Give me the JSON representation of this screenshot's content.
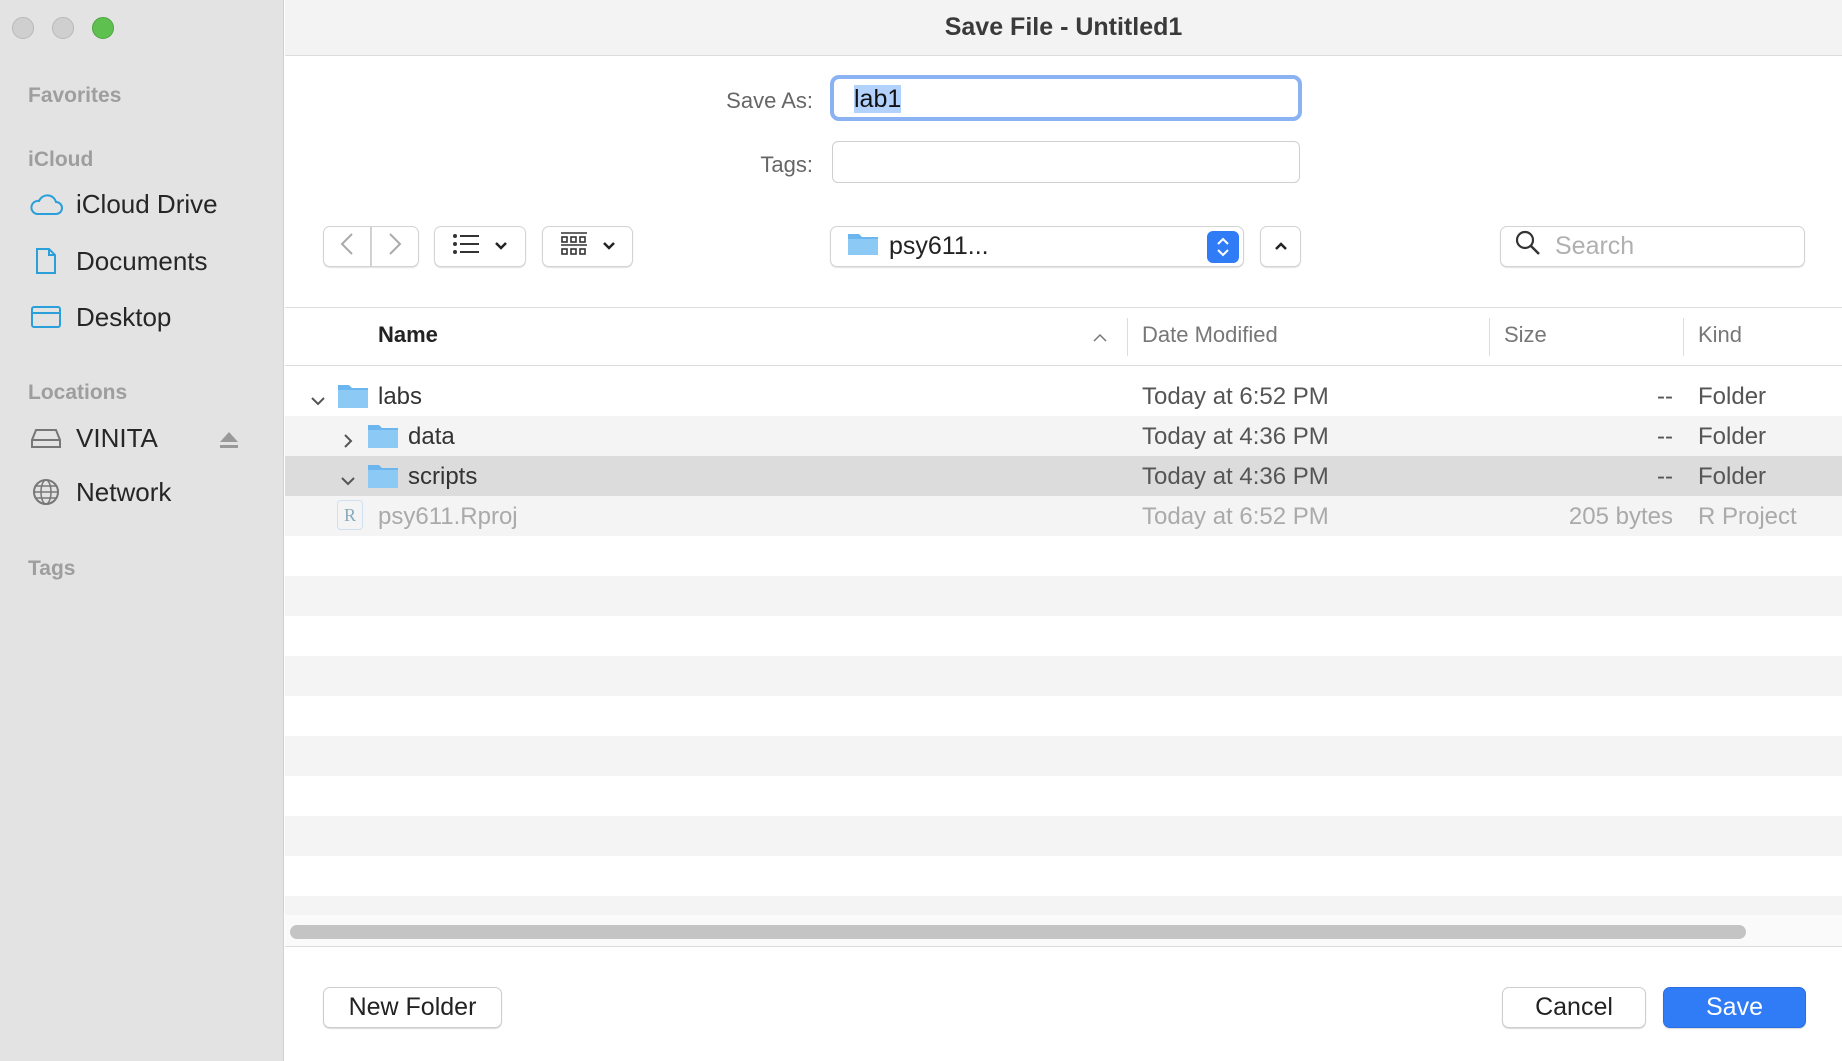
{
  "window": {
    "title": "Save File - Untitled1"
  },
  "sidebar": {
    "sections": {
      "favorites": "Favorites",
      "icloud": "iCloud",
      "locations": "Locations",
      "tags": "Tags"
    },
    "items": [
      {
        "label": "iCloud Drive",
        "icon": "cloud-icon"
      },
      {
        "label": "Documents",
        "icon": "document-icon"
      },
      {
        "label": "Desktop",
        "icon": "desktop-icon"
      },
      {
        "label": "VINITA",
        "icon": "drive-icon"
      },
      {
        "label": "Network",
        "icon": "globe-icon"
      }
    ]
  },
  "form": {
    "save_as_label": "Save As:",
    "save_as_value": "lab1",
    "tags_label": "Tags:",
    "tags_value": ""
  },
  "toolbar": {
    "location": "psy611...",
    "search_placeholder": "Search"
  },
  "table": {
    "headers": {
      "name": "Name",
      "date": "Date Modified",
      "size": "Size",
      "kind": "Kind"
    },
    "rows": [
      {
        "name": "labs",
        "date": "Today at 6:52 PM",
        "size": "--",
        "kind": "Folder",
        "expanded": true,
        "level": 0
      },
      {
        "name": "data",
        "date": "Today at 4:36 PM",
        "size": "--",
        "kind": "Folder",
        "expanded": false,
        "level": 1
      },
      {
        "name": "scripts",
        "date": "Today at 4:36 PM",
        "size": "--",
        "kind": "Folder",
        "expanded": true,
        "level": 1,
        "selected": true
      },
      {
        "name": "psy611.Rproj",
        "date": "Today at 6:52 PM",
        "size": "205 bytes",
        "kind": "R Project",
        "disabled": true
      }
    ]
  },
  "footer": {
    "new_folder": "New Folder",
    "cancel": "Cancel",
    "save": "Save"
  },
  "colors": {
    "accent": "#2f7cf6",
    "folder": "#6bb6ee",
    "selected_row": "#dcdcdc"
  }
}
